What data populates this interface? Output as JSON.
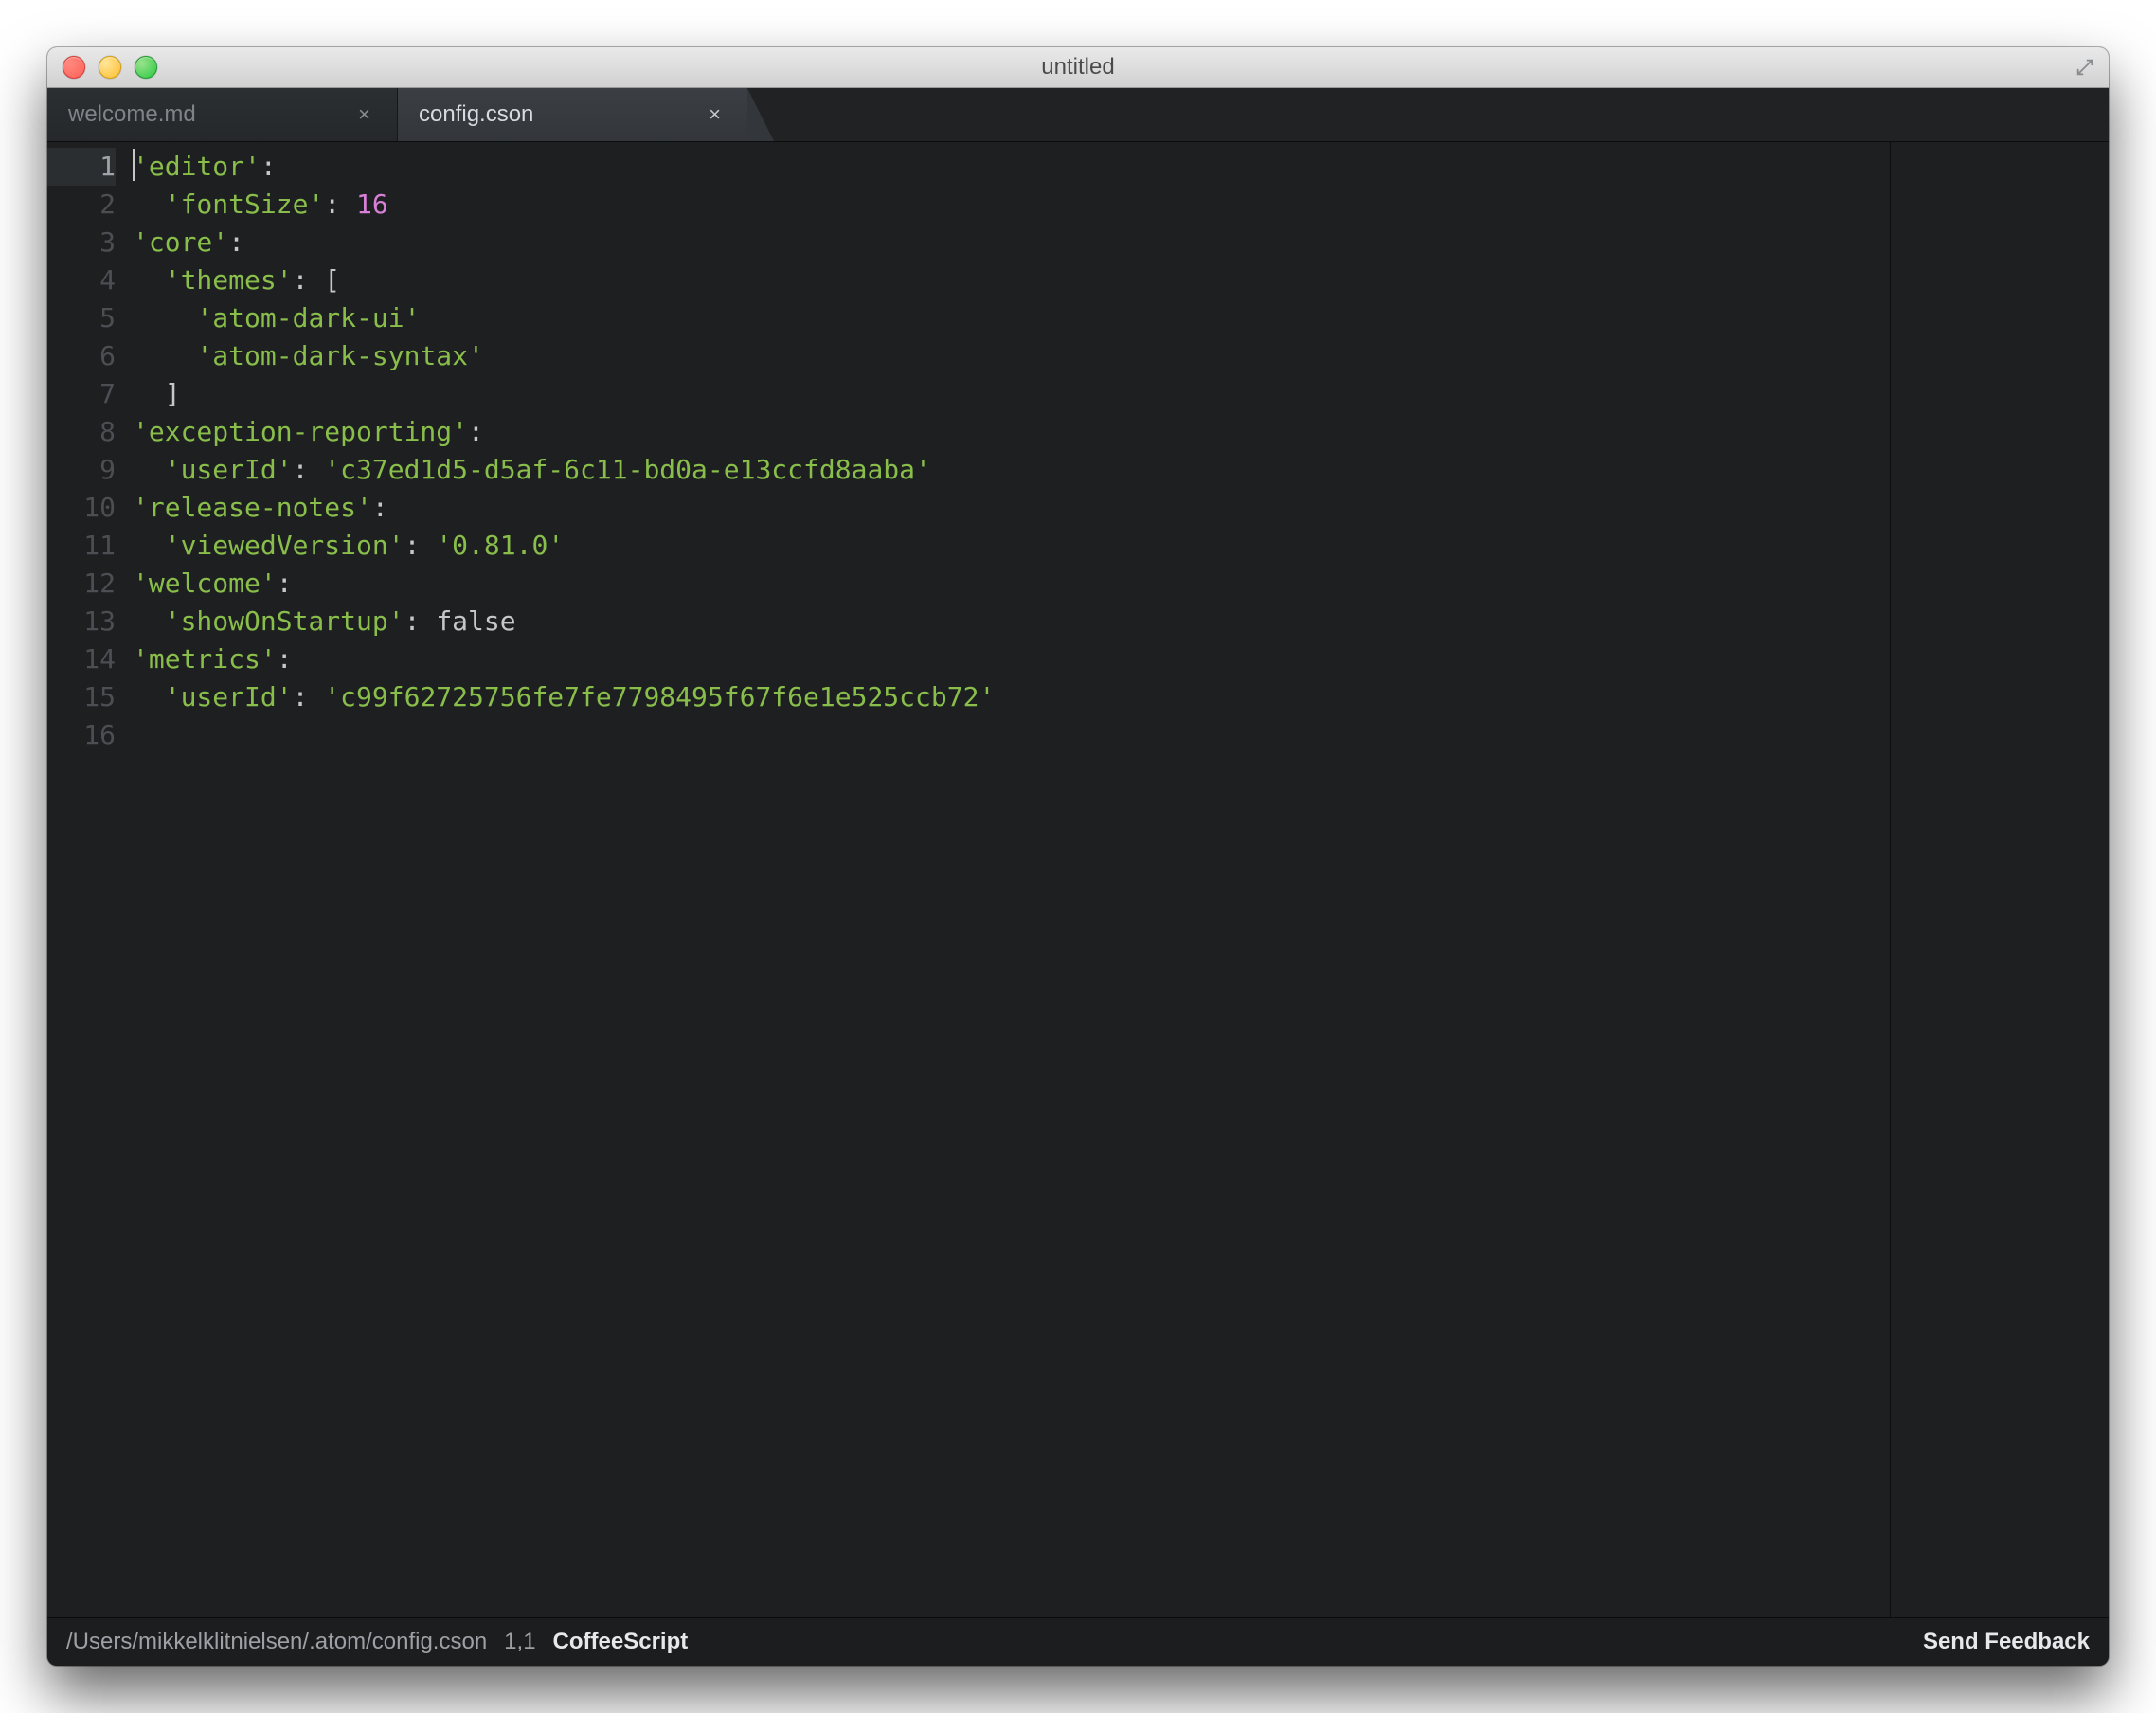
{
  "window": {
    "title": "untitled"
  },
  "tabs": [
    {
      "label": "welcome.md",
      "active": false
    },
    {
      "label": "config.cson",
      "active": true
    }
  ],
  "editor": {
    "line_count": 16,
    "current_line": 1,
    "lines": [
      {
        "indent": 0,
        "segments": [
          {
            "t": "cursor"
          },
          {
            "t": "str",
            "v": "'editor'"
          },
          {
            "t": "punc",
            "v": ":"
          }
        ]
      },
      {
        "indent": 1,
        "segments": [
          {
            "t": "str",
            "v": "'fontSize'"
          },
          {
            "t": "punc",
            "v": ": "
          },
          {
            "t": "num",
            "v": "16"
          }
        ]
      },
      {
        "indent": 0,
        "segments": [
          {
            "t": "str",
            "v": "'core'"
          },
          {
            "t": "punc",
            "v": ":"
          }
        ]
      },
      {
        "indent": 1,
        "segments": [
          {
            "t": "str",
            "v": "'themes'"
          },
          {
            "t": "punc",
            "v": ": ["
          }
        ]
      },
      {
        "indent": 2,
        "segments": [
          {
            "t": "str",
            "v": "'atom-dark-ui'"
          }
        ]
      },
      {
        "indent": 2,
        "segments": [
          {
            "t": "str",
            "v": "'atom-dark-syntax'"
          }
        ]
      },
      {
        "indent": 1,
        "segments": [
          {
            "t": "punc",
            "v": "]"
          }
        ]
      },
      {
        "indent": 0,
        "segments": [
          {
            "t": "str",
            "v": "'exception-reporting'"
          },
          {
            "t": "punc",
            "v": ":"
          }
        ]
      },
      {
        "indent": 1,
        "segments": [
          {
            "t": "str",
            "v": "'userId'"
          },
          {
            "t": "punc",
            "v": ": "
          },
          {
            "t": "str",
            "v": "'c37ed1d5-d5af-6c11-bd0a-e13ccfd8aaba'"
          }
        ]
      },
      {
        "indent": 0,
        "segments": [
          {
            "t": "str",
            "v": "'release-notes'"
          },
          {
            "t": "punc",
            "v": ":"
          }
        ]
      },
      {
        "indent": 1,
        "segments": [
          {
            "t": "str",
            "v": "'viewedVersion'"
          },
          {
            "t": "punc",
            "v": ": "
          },
          {
            "t": "str",
            "v": "'0.81.0'"
          }
        ]
      },
      {
        "indent": 0,
        "segments": [
          {
            "t": "str",
            "v": "'welcome'"
          },
          {
            "t": "punc",
            "v": ":"
          }
        ]
      },
      {
        "indent": 1,
        "segments": [
          {
            "t": "str",
            "v": "'showOnStartup'"
          },
          {
            "t": "punc",
            "v": ": "
          },
          {
            "t": "bool",
            "v": "false"
          }
        ]
      },
      {
        "indent": 0,
        "segments": [
          {
            "t": "str",
            "v": "'metrics'"
          },
          {
            "t": "punc",
            "v": ":"
          }
        ]
      },
      {
        "indent": 1,
        "segments": [
          {
            "t": "str",
            "v": "'userId'"
          },
          {
            "t": "punc",
            "v": ": "
          },
          {
            "t": "str",
            "v": "'c99f62725756fe7fe7798495f67f6e1e525ccb72'"
          }
        ]
      },
      {
        "indent": 0,
        "segments": []
      }
    ]
  },
  "status": {
    "path": "/Users/mikkelklitnielsen/.atom/config.cson",
    "cursor": "1,1",
    "language": "CoffeeScript",
    "feedback": "Send Feedback"
  }
}
